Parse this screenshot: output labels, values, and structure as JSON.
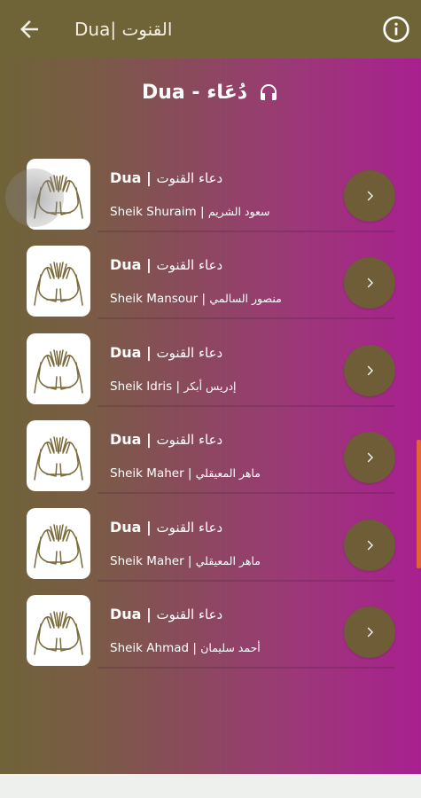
{
  "appbar": {
    "title": "Dua| القنوت",
    "back_icon": "arrow-left-icon",
    "info_icon": "info-circle-icon"
  },
  "section": {
    "title": "Dua - دُعَاء",
    "icon": "headphones-icon"
  },
  "items": [
    {
      "title_latin": "Dua | ",
      "title_arabic": "دعاء القنوت",
      "reciter_latin": "Sheik Shuraim | ",
      "reciter_arabic": "سعود الشريم"
    },
    {
      "title_latin": "Dua | ",
      "title_arabic": "دعاء القنوت",
      "reciter_latin": "Sheik Mansour | ",
      "reciter_arabic": "منصور السالمي"
    },
    {
      "title_latin": "Dua | ",
      "title_arabic": "دعاء القنوت",
      "reciter_latin": "Sheik Idris | ",
      "reciter_arabic": "إدريس أبكر"
    },
    {
      "title_latin": "Dua | ",
      "title_arabic": "دعاء القنوت",
      "reciter_latin": "Sheik Maher | ",
      "reciter_arabic": "ماهر المعيقلي"
    },
    {
      "title_latin": "Dua | ",
      "title_arabic": "دعاء القنوت",
      "reciter_latin": "Sheik Maher | ",
      "reciter_arabic": "ماهر المعيقلي"
    },
    {
      "title_latin": "Dua | ",
      "title_arabic": "دعاء القنوت",
      "reciter_latin": "Sheik Ahmad | ",
      "reciter_arabic": "أحمد سليمان"
    }
  ],
  "colors": {
    "appbar": "#6f6338",
    "gradient_start": "#6f6338",
    "gradient_end": "#a8208f",
    "play_button": "#6e5d37",
    "scrollbar": "#e0633a"
  }
}
